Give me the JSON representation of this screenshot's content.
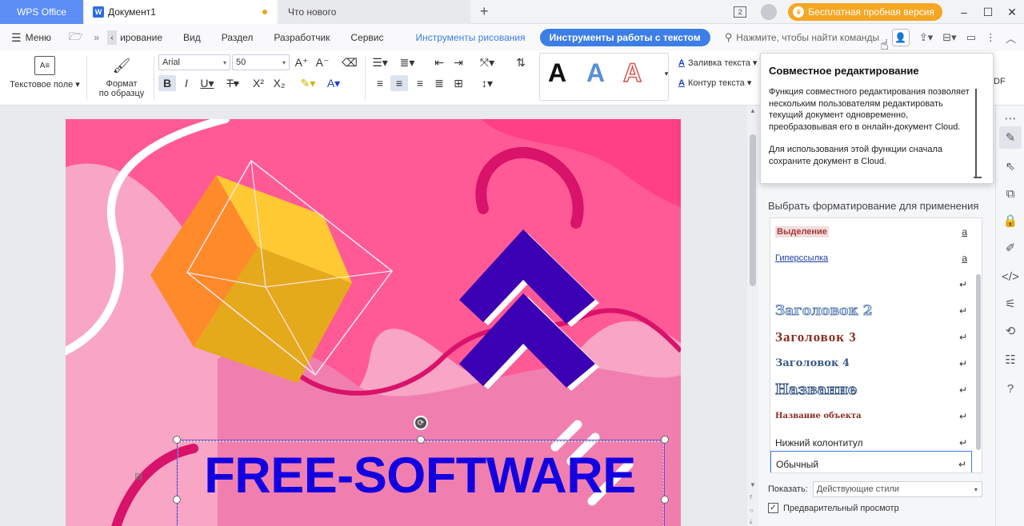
{
  "titlebar": {
    "app_tab": "WPS Office",
    "doc_tab": "Документ1",
    "new_tab": "Что нового",
    "window_count": "2",
    "trial_label": "Бесплатная пробная версия"
  },
  "menubar": {
    "menu": "Меню",
    "items": [
      "ирование",
      "Вид",
      "Раздел",
      "Разработчик",
      "Сервис"
    ],
    "draw_tools": "Инструменты рисования",
    "text_tools": "Инструменты работы с текстом",
    "search_placeholder": "Нажмите, чтобы найти команды"
  },
  "ribbon": {
    "text_field": "Текстовое поле",
    "format_painter_line1": "Формат",
    "format_painter_line2": "по образцу",
    "font_name": "Arial",
    "font_size": "50",
    "text_fill": "Заливка текста",
    "text_outline": "Контур текста"
  },
  "tooltip": {
    "title": "Совместное редактирование",
    "para1": "Функция совместного редактирования позволяет нескольким пользователям редактировать текущий документ одновременно, преобразовывая его в онлайн-документ Cloud.",
    "para2": "Для использования этой функции сначала сохраните документ в Cloud.",
    "pdf_peek": "DF"
  },
  "panel": {
    "title": "Выбрать форматирование для применения",
    "styles": [
      {
        "label": "Выделение",
        "marker": "a"
      },
      {
        "label": "Гиперссылка",
        "marker": "a"
      },
      {
        "label": "",
        "marker": "↵"
      },
      {
        "label": "Заголовок 2",
        "marker": "↵"
      },
      {
        "label": "Заголовок 3",
        "marker": "↵"
      },
      {
        "label": "Заголовок 4",
        "marker": "↵"
      },
      {
        "label": "Название",
        "marker": "↵"
      },
      {
        "label": "Название объекта",
        "marker": "↵"
      },
      {
        "label": "Нижний колонтитул",
        "marker": "↵"
      },
      {
        "label": "Обычный",
        "marker": "↵"
      }
    ],
    "show_label": "Показать:",
    "show_value": "Действующие стили",
    "preview_label": "Предварительный просмотр"
  },
  "document": {
    "headline": "FREE-SOFTWARE"
  },
  "colors": {
    "accent": "#3c7ee6",
    "page_bg": "#ff5a96",
    "headline": "#1200e0",
    "trial": "#f5a623"
  }
}
